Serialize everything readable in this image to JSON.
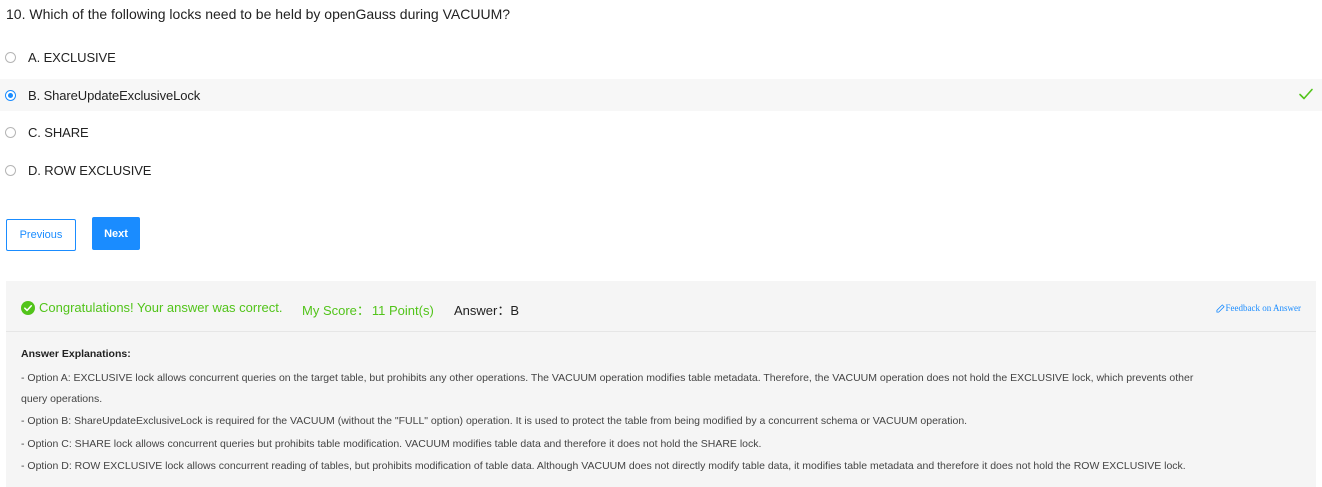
{
  "question": {
    "text": "10. Which of the following locks need to be held by openGauss during VACUUM?"
  },
  "options": [
    {
      "label": "A. EXCLUSIVE",
      "selected": false
    },
    {
      "label": "B. ShareUpdateExclusiveLock",
      "selected": true,
      "correct": true
    },
    {
      "label": "C. SHARE",
      "selected": false
    },
    {
      "label": "D. ROW EXCLUSIVE",
      "selected": false
    }
  ],
  "navigation": {
    "previous_label": "Previous",
    "next_label": "Next"
  },
  "result": {
    "congrats": "Congratulations! Your answer was correct.",
    "score_label": "My Score：",
    "score_value": "11 Point(s)",
    "answer_label": "Answer：",
    "answer_value": "B",
    "feedback_label": "Feedback on Answer"
  },
  "explanation": {
    "title": "Answer Explanations:",
    "lines": [
      "- Option A: EXCLUSIVE lock allows concurrent queries on the target table, but prohibits any other operations. The VACUUM operation modifies table metadata. Therefore, the VACUUM operation does not hold the EXCLUSIVE lock, which prevents other",
      "query operations.",
      "- Option B: ShareUpdateExclusiveLock is required for the VACUUM (without the \"FULL\" option) operation. It is used to protect the table from being modified by a concurrent schema or VACUUM operation.",
      "- Option C: SHARE lock allows concurrent queries but prohibits table modification. VACUUM modifies table data and therefore it does not hold the SHARE lock.",
      "- Option D: ROW EXCLUSIVE lock allows concurrent reading of tables, but prohibits modification of table data. Although VACUUM does not directly modify table data, it modifies table metadata and therefore it does not hold the ROW EXCLUSIVE lock."
    ]
  },
  "colors": {
    "accent": "#1a8cff",
    "success": "#52c41a",
    "panel_bg": "#f5f5f5"
  },
  "icons": {
    "correct": "check-icon",
    "congrats": "check-circle-icon",
    "feedback": "edit-icon"
  }
}
